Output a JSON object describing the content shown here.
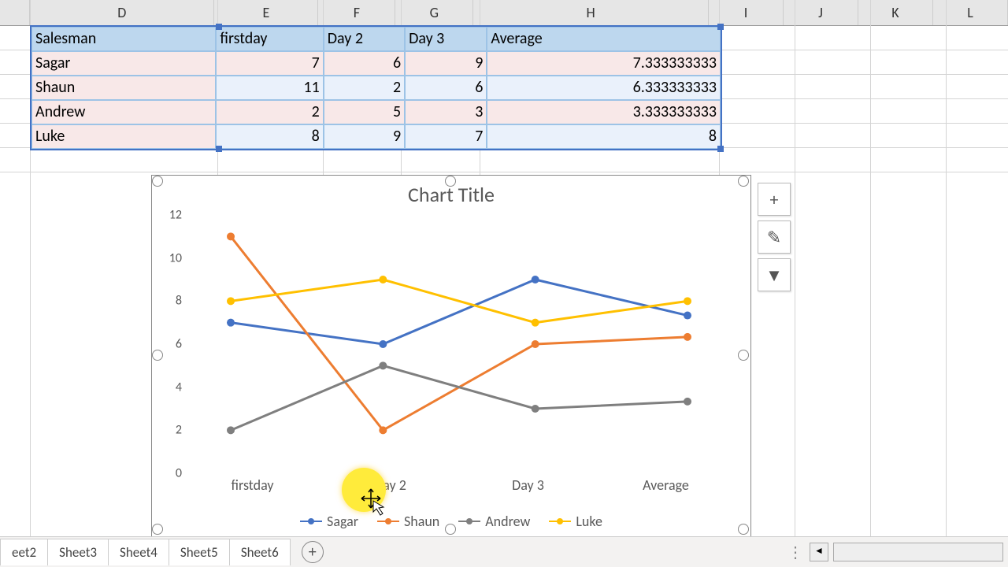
{
  "columns": [
    "D",
    "E",
    "F",
    "G",
    "H",
    "I",
    "J",
    "K",
    "L"
  ],
  "table": {
    "headers": [
      "Salesman",
      "firstday",
      "Day 2",
      "Day 3",
      "Average"
    ],
    "rows": [
      {
        "name": "Sagar",
        "v": [
          "7",
          "6",
          "9",
          "7.333333333"
        ]
      },
      {
        "name": "Shaun",
        "v": [
          "11",
          "2",
          "6",
          "6.333333333"
        ]
      },
      {
        "name": "Andrew",
        "v": [
          "2",
          "5",
          "3",
          "3.333333333"
        ]
      },
      {
        "name": "Luke",
        "v": [
          "8",
          "9",
          "7",
          "8"
        ]
      }
    ]
  },
  "chart_data": {
    "type": "line",
    "title": "Chart Title",
    "categories": [
      "firstday",
      "Day 2",
      "Day 3",
      "Average"
    ],
    "ylim": [
      0,
      12
    ],
    "yticks": [
      0,
      2,
      4,
      6,
      8,
      10,
      12
    ],
    "series": [
      {
        "name": "Sagar",
        "color": "#4472c4",
        "values": [
          7,
          6,
          9,
          7.333333333
        ]
      },
      {
        "name": "Shaun",
        "color": "#ed7d31",
        "values": [
          11,
          2,
          6,
          6.333333333
        ]
      },
      {
        "name": "Andrew",
        "color": "#7f7f7f",
        "values": [
          2,
          5,
          3,
          3.333333333
        ]
      },
      {
        "name": "Luke",
        "color": "#ffc000",
        "values": [
          8,
          9,
          7,
          8
        ]
      }
    ]
  },
  "side_buttons": {
    "plus": "+",
    "brush": "✎",
    "filter": "▼"
  },
  "sheets": [
    "eet2",
    "Sheet3",
    "Sheet4",
    "Sheet5",
    "Sheet6"
  ],
  "add_sheet": "+",
  "scroll_dots": "⋮",
  "scroll_arrow": "◄"
}
